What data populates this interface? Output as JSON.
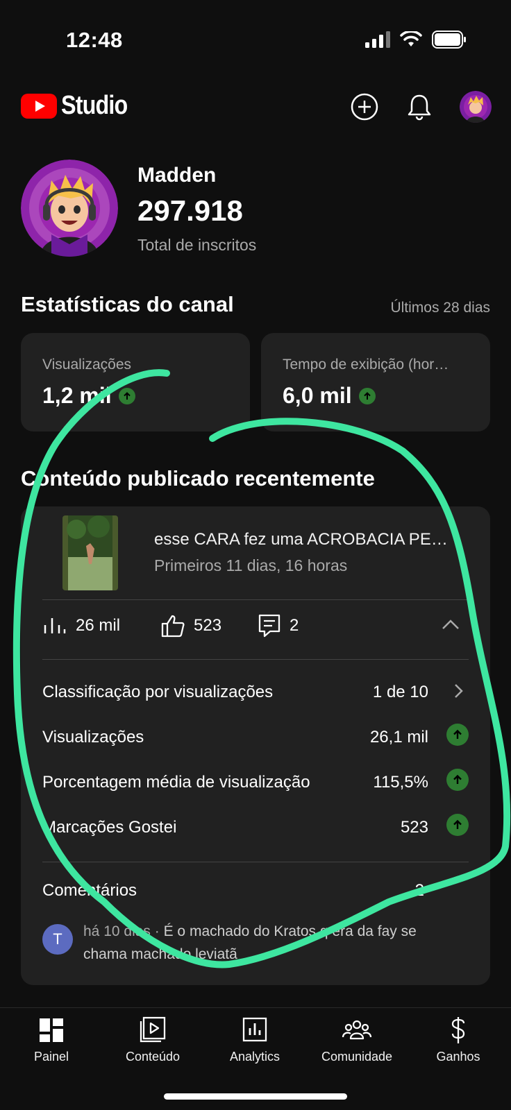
{
  "status_bar": {
    "time": "12:48"
  },
  "app": {
    "logo_text": "Studio",
    "icons": [
      "create-plus-icon",
      "bell-icon",
      "account-avatar"
    ]
  },
  "channel": {
    "name": "Madden",
    "subscribers": "297.918",
    "subscribers_label": "Total de inscritos"
  },
  "stats": {
    "title": "Estatísticas do canal",
    "period": "Últimos 28 dias",
    "cards": [
      {
        "label": "Visualizações",
        "value": "1,2 mil",
        "trend": "up"
      },
      {
        "label": "Tempo de exibição (hor…",
        "value": "6,0 mil",
        "trend": "up"
      }
    ]
  },
  "recent": {
    "title": "Conteúdo publicado recentemente",
    "video": {
      "title": "esse CARA fez uma ACROBACIA PE…",
      "subtitle": "Primeiros 11 dias, 16 horas",
      "views": "26 mil",
      "likes": "523",
      "comments": "2"
    },
    "rows": [
      {
        "label": "Classificação por visualizações",
        "value": "1 de 10",
        "end": "chevron-right-icon"
      },
      {
        "label": "Visualizações",
        "value": "26,1 mil",
        "end": "up-arrow-icon"
      },
      {
        "label": "Porcentagem média de visualização",
        "value": "115,5%",
        "end": "up-arrow-icon"
      },
      {
        "label": "Marcações Gostei",
        "value": "523",
        "end": "up-arrow-icon"
      }
    ],
    "comments_label": "Comentários",
    "comments_count": "2",
    "comment": {
      "avatar_letter": "T",
      "meta": "há 10 dias",
      "separator": " · ",
      "text": "É o machado do Kratos q era da fay se chama machado leviatã"
    }
  },
  "nav": {
    "items": [
      {
        "label": "Painel",
        "icon": "dashboard-icon"
      },
      {
        "label": "Conteúdo",
        "icon": "content-play-icon"
      },
      {
        "label": "Analytics",
        "icon": "analytics-bar-icon"
      },
      {
        "label": "Comunidade",
        "icon": "community-people-icon"
      },
      {
        "label": "Ganhos",
        "icon": "dollar-icon"
      }
    ]
  },
  "colors": {
    "background": "#0f0f0f",
    "card": "#212121",
    "youtube_red": "#ff0000",
    "trend_green": "#2e7d32",
    "annotation": "#3ee6a0"
  }
}
